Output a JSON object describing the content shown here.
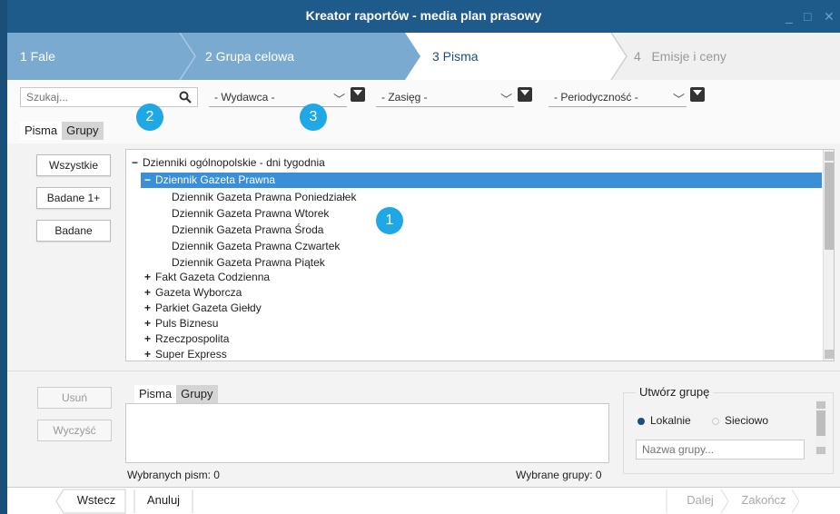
{
  "window": {
    "title": "Kreator raportów - media plan prasowy",
    "minimize_icon": "minimize-icon",
    "maximize_icon": "maximize-icon",
    "close_icon": "close-icon"
  },
  "wizard": {
    "steps": [
      {
        "label": "1  Fale",
        "state": "done"
      },
      {
        "label": "2 Grupa celowa",
        "state": "done"
      },
      {
        "label": "3 Pisma",
        "state": "active"
      },
      {
        "label": "4   Emisje i ceny",
        "state": "disabled"
      }
    ]
  },
  "filters": {
    "search_placeholder": "Szukaj...",
    "search_icon": "search-icon",
    "publisher": "- Wydawca -",
    "reach": "- Zasięg -",
    "periodicity": "- Periodyczność -",
    "filter_icon": "filter-icon"
  },
  "badges": [
    "1",
    "2",
    "3"
  ],
  "top_tabs": [
    "Pisma",
    "Grupy"
  ],
  "left_buttons": {
    "all": "Wszystkie",
    "researched_plus": "Badane 1+",
    "researched": "Badane"
  },
  "tree": [
    {
      "sign": "−",
      "label": "Dzienniki ogólnopolskie - dni tygodnia",
      "level": 0
    },
    {
      "sign": "−",
      "label": "Dziennik Gazeta Prawna",
      "level": 1,
      "selected": true
    },
    {
      "sign": "",
      "label": "Dziennik Gazeta Prawna Poniedziałek",
      "level": 2
    },
    {
      "sign": "",
      "label": "Dziennik Gazeta Prawna Wtorek",
      "level": 2
    },
    {
      "sign": "",
      "label": "Dziennik Gazeta Prawna Środa",
      "level": 2
    },
    {
      "sign": "",
      "label": "Dziennik Gazeta Prawna Czwartek",
      "level": 2
    },
    {
      "sign": "",
      "label": "Dziennik Gazeta Prawna Piątek",
      "level": 2
    },
    {
      "sign": "+",
      "label": "Fakt Gazeta Codzienna",
      "level": 1
    },
    {
      "sign": "+",
      "label": "Gazeta Wyborcza",
      "level": 1
    },
    {
      "sign": "+",
      "label": "Parkiet Gazeta Giełdy",
      "level": 1
    },
    {
      "sign": "+",
      "label": "Puls Biznesu",
      "level": 1
    },
    {
      "sign": "+",
      "label": "Rzeczpospolita",
      "level": 1
    },
    {
      "sign": "+",
      "label": "Super Express",
      "level": 1
    }
  ],
  "bottom": {
    "remove": "Usuń",
    "clear": "Wyczyść",
    "tabs": [
      "Pisma",
      "Grupy"
    ],
    "selected_titles": "Wybranych pism: 0",
    "selected_groups": "Wybrane grupy: 0",
    "create_group": "Utwórz grupę",
    "local": "Lokalnie",
    "network": "Sieciowo",
    "group_name_placeholder": "Nazwa grupy..."
  },
  "footer": {
    "back": "Wstecz",
    "cancel": "Anuluj",
    "next": "Dalej",
    "finish": "Zakończ"
  },
  "colors": {
    "title_bar": "#1e5a8a",
    "wizard_done": "#7aaad0",
    "selection": "#3a8fd6",
    "badge": "#20a8e6"
  }
}
